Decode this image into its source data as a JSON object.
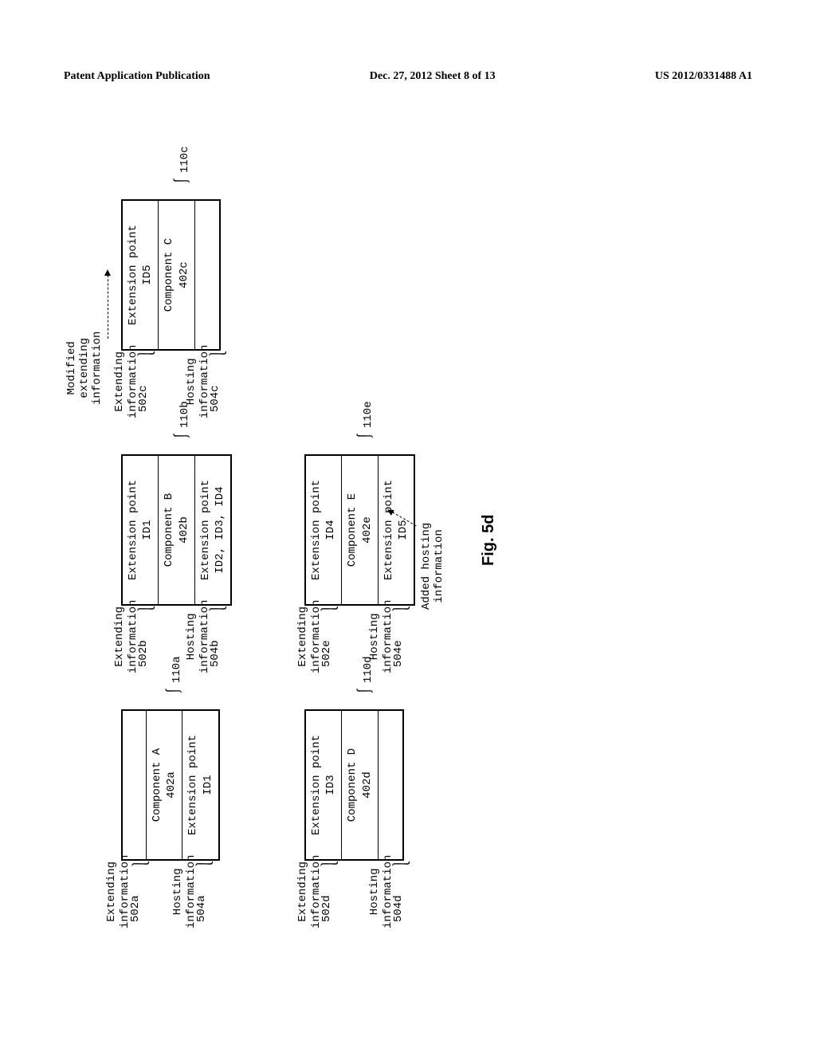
{
  "header": {
    "left": "Patent Application Publication",
    "center": "Dec. 27, 2012  Sheet 8 of 13",
    "right": "US 2012/0331488 A1"
  },
  "figure_label": "Fig. 5d",
  "annotations": {
    "modified_extending": "Modified\nextending\ninformation",
    "added_hosting": "Added hosting\ninformation"
  },
  "components": {
    "a": {
      "name": "Component A",
      "id": "402a",
      "extending_ref": "502a",
      "hosting_ref": "504a",
      "ref": "110a",
      "extending_label": "Extending\ninformation",
      "hosting_label": "Hosting\ninformation",
      "ext_point_top": "",
      "ext_point_bottom": "Extension point\nID1"
    },
    "b": {
      "name": "Component B",
      "id": "402b",
      "extending_ref": "502b",
      "hosting_ref": "504b",
      "ref": "110b",
      "extending_label": "Extending\ninformation",
      "hosting_label": "Hosting\ninformation",
      "ext_point_top": "Extension point\nID1",
      "ext_point_bottom": "Extension point\nID2, ID3, ID4"
    },
    "c": {
      "name": "Component C",
      "id": "402c",
      "extending_ref": "502c",
      "hosting_ref": "504c",
      "ref": "110c",
      "extending_label": "Extending\ninformation",
      "hosting_label": "Hosting\ninformation",
      "ext_point_top": "Extension point\nID5",
      "ext_point_bottom": ""
    },
    "d": {
      "name": "Component D",
      "id": "402d",
      "extending_ref": "502d",
      "hosting_ref": "504d",
      "ref": "110d",
      "extending_label": "Extending\ninformation",
      "hosting_label": "Hosting\ninformation",
      "ext_point_top": "Extension point\nID3",
      "ext_point_bottom": ""
    },
    "e": {
      "name": "Component E",
      "id": "402e",
      "extending_ref": "502e",
      "hosting_ref": "504e",
      "ref": "110e",
      "extending_label": "Extending\ninformation",
      "hosting_label": "Hosting\ninformation",
      "ext_point_top": "Extension point\nID4",
      "ext_point_bottom": "Extension point\nID5"
    }
  }
}
